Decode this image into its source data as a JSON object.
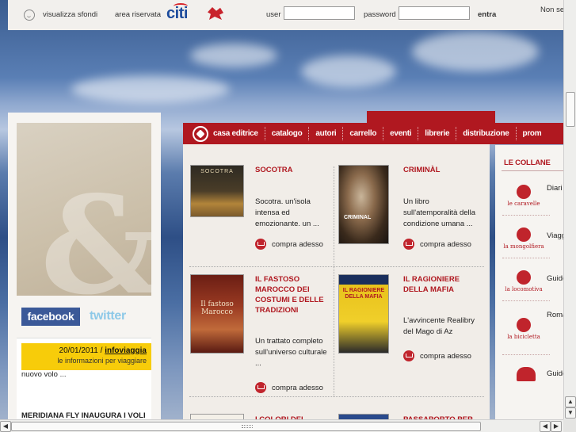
{
  "topbar": {
    "show_backgrounds": "visualizza sfondi",
    "reserved_area": "area riservata",
    "sponsor_logo": "citi",
    "user_label": "user",
    "user_value": "",
    "password_label": "password",
    "password_value": "",
    "login_button": "entra",
    "right_text": "Non se"
  },
  "sidebar": {
    "facebook": "facebook",
    "twitter": "twitter",
    "news": {
      "date": "20/01/2011 / ",
      "source": "infoviaggia",
      "subtitle": "le informazioni per viaggiare",
      "body": "nuovo volo ...",
      "title": "MERIDIANA FLY INAUGURA I VOLI"
    }
  },
  "nav": {
    "items": [
      "casa editrice",
      "catalogo",
      "autori",
      "carrello",
      "eventi",
      "librerie",
      "distribuzione",
      "prom"
    ]
  },
  "books": [
    {
      "title": "SOCOTRA",
      "desc": "Socotra. un'isola intensa ed emozionante. un ...",
      "buy": "compra adesso",
      "cover_text": "SOCOTRA"
    },
    {
      "title": "CRIMINÀL",
      "desc": "Un libro sull'atemporalità della condizione umana ...",
      "buy": "compra adesso",
      "cover_text": "CRIMINAL"
    },
    {
      "title": "IL FASTOSO MAROCCO DEI COSTUMI E DELLE TRADIZIONI",
      "desc": "Un trattato completo sull'universo culturale ...",
      "buy": "compra adesso",
      "cover_text": "Il fastoso Marocco"
    },
    {
      "title": "IL RAGIONIERE DELLA MAFIA",
      "desc": "L'avvincente Realibry del Mago di Az",
      "buy": "compra adesso",
      "cover_text": "IL RAGIONIERE DELLA MAFIA"
    },
    {
      "title": "I COLORI DEL"
    },
    {
      "title": "PASSAPORTO PER"
    }
  ],
  "collane": {
    "heading": "LE COLLANE",
    "items": [
      {
        "label": "le caravelle",
        "text": "Diari"
      },
      {
        "label": "la mongolfiera",
        "text": "Viagg"
      },
      {
        "label": "la locomotiva",
        "text": "Guide"
      },
      {
        "label": "la bicicletta",
        "text": "Roma"
      },
      {
        "label": "",
        "text": "Guide"
      }
    ]
  },
  "scroll": {
    "up": "▲",
    "down": "▼",
    "left": "◀",
    "right": "▶"
  }
}
